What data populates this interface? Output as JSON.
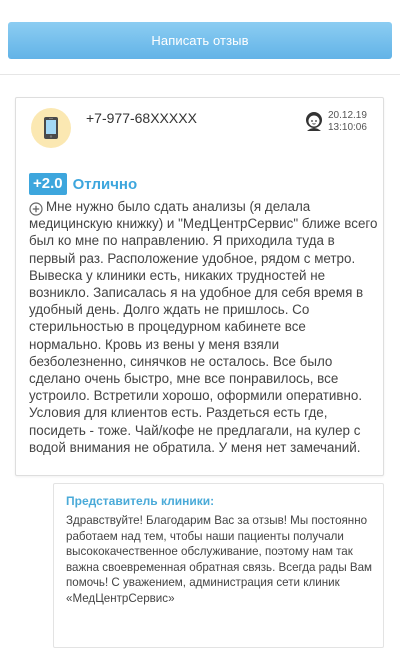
{
  "top_button": {
    "label": "Написать отзыв"
  },
  "review": {
    "author": "+7-977-68XXXXX",
    "date": "20.12.19",
    "time": "13:10:06",
    "score": "+2.0",
    "rating_label": "Отлично",
    "text": "Мне нужно было сдать анализы (я делала медицинскую книжку) и \"МедЦентрСервис\" ближе всего был ко мне по направлению. Я приходила туда в первый раз. Расположение удобное, рядом с метро. Вывеска у клиники есть, никаких трудностей не возникло. Записалась я на удобное для себя время в удобный день. Долго ждать не пришлось. Со стерильностью в процедурном кабинете все нормально. Кровь из вены у меня взяли безболезненно, синячков не осталось. Все было сделано очень быстро, мне все понравилось, все устроило. Встретили хорошо, оформили оперативно. Условия для клиентов есть. Раздеться есть где, посидеть - тоже. Чай/кофе не предлагали, на кулер с водой внимания не обратила. У меня нет замечаний."
  },
  "reply": {
    "title": "Представитель клиники:",
    "text": "Здравствуйте! Благодарим Вас за отзыв! Мы постоянно работаем над тем, чтобы наши пациенты получали высококачественное обслуживание, поэтому нам так важна своевременная обратная связь. Всегда рады Вам помочь! С уважением, администрация сети клиник «МедЦентрСервис»"
  },
  "colors": {
    "accent": "#3da6dd",
    "button_top": "#8ccdf2",
    "button_bottom": "#62b3e7",
    "phone_badge_bg": "#fbe8b2"
  },
  "icons": {
    "author_avatar": "phone-icon",
    "gender_icon": "woman-icon",
    "expand_icon": "plus-circle-icon"
  }
}
